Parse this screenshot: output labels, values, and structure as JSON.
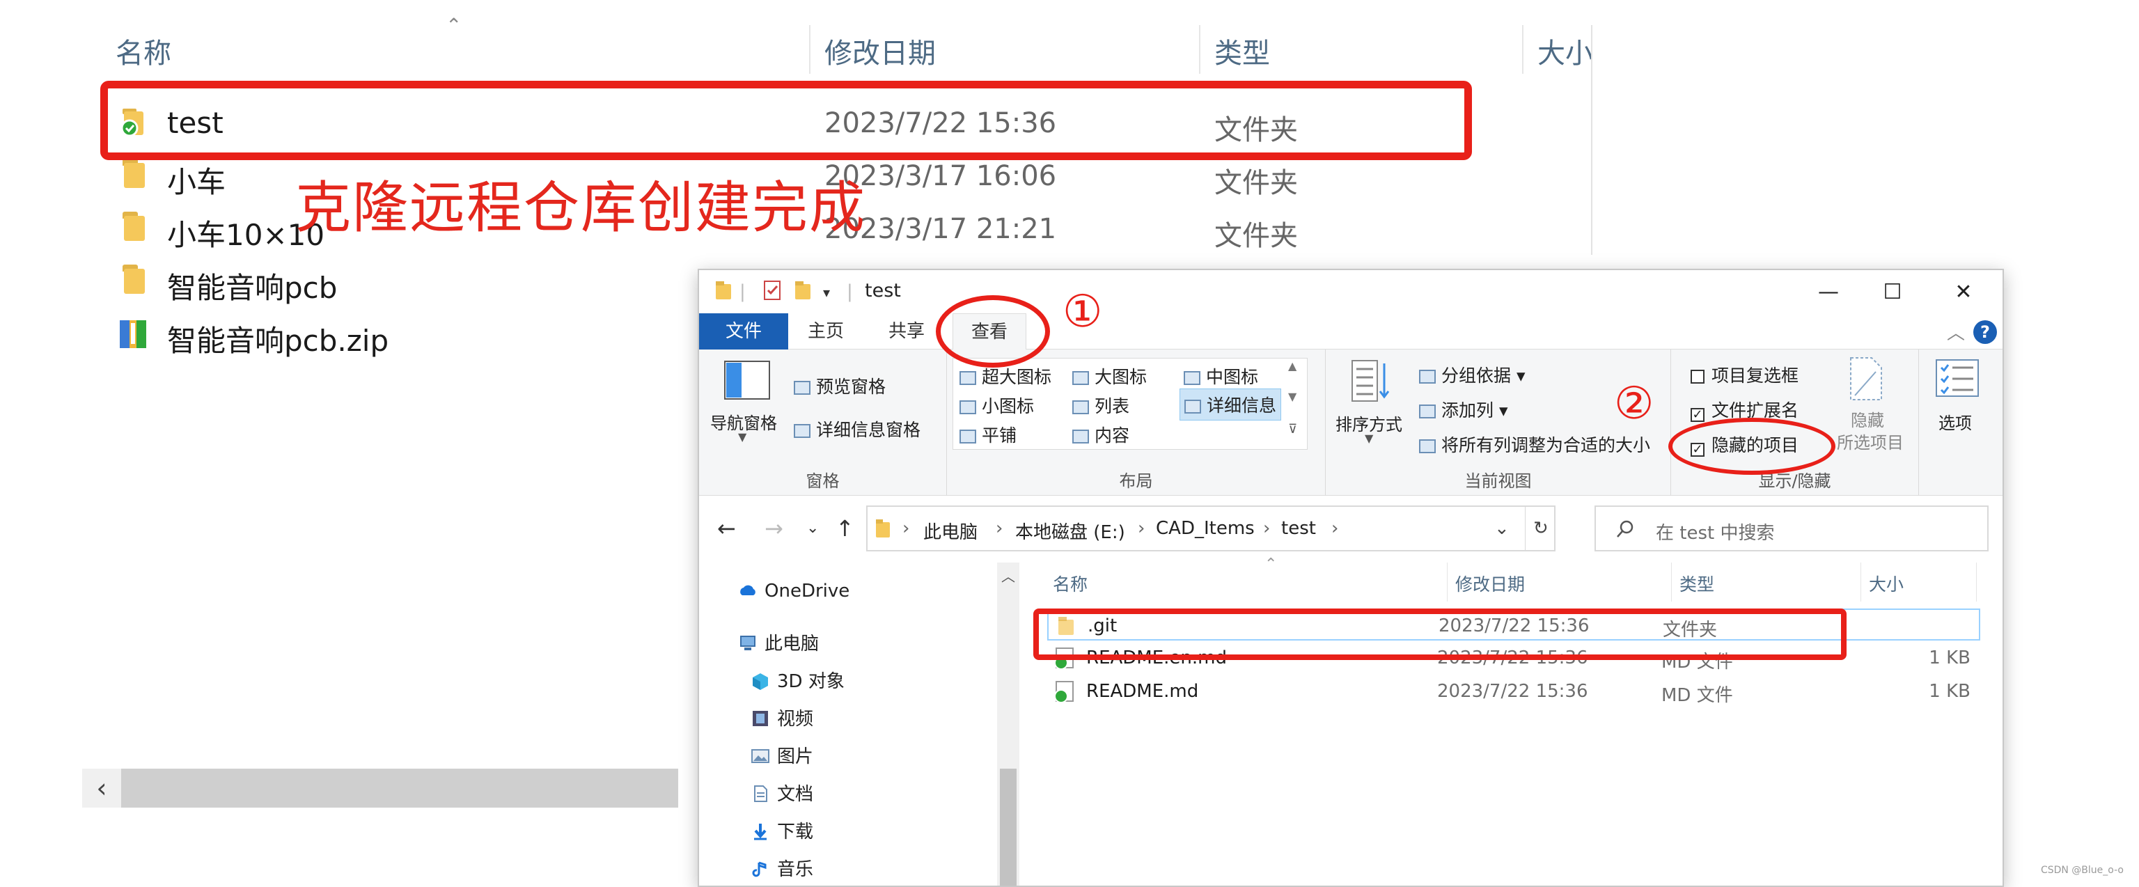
{
  "background": {
    "columns": {
      "name": "名称",
      "modified": "修改日期",
      "type": "类型",
      "size": "大小"
    },
    "rows": [
      {
        "name": "test",
        "date": "2023/7/22 15:36",
        "type": "文件夹",
        "icon": "git-folder-icon"
      },
      {
        "name": "小车",
        "date": "2023/3/17 16:06",
        "type": "文件夹",
        "icon": "folder-icon"
      },
      {
        "name": "小车10×10",
        "date": "2023/3/17 21:21",
        "type": "文件夹",
        "icon": "folder-icon"
      },
      {
        "name": "智能音响pcb",
        "type": "",
        "icon": "folder-icon"
      },
      {
        "name": "智能音响pcb.zip",
        "type": "",
        "icon": "zip-icon"
      }
    ],
    "scroll_left_glyph": "‹"
  },
  "caption": "克隆远程仓库创建完成",
  "annotations": {
    "step1": "①",
    "step2": "②"
  },
  "window": {
    "title": "test",
    "controls": {
      "minimize": "—",
      "maximize": "☐",
      "close": "✕"
    },
    "tabs": {
      "file": "文件",
      "home": "主页",
      "share": "共享",
      "view": "查看"
    },
    "help": "?",
    "ribbon": {
      "pane": {
        "nav_pane": "导航窗格",
        "preview": "预览窗格",
        "details": "详细信息窗格",
        "label": "窗格"
      },
      "layout": {
        "items": [
          "超大图标",
          "大图标",
          "中图标",
          "小图标",
          "列表",
          "详细信息",
          "平铺",
          "内容"
        ],
        "label": "布局"
      },
      "current_view": {
        "sort": "排序方式",
        "group": "分组依据",
        "add_col": "添加列",
        "fit_cols": "将所有列调整为合适的大小",
        "label": "当前视图"
      },
      "show_hide": {
        "item_checkboxes": "项目复选框",
        "extensions": "文件扩展名",
        "hidden_items": "隐藏的项目",
        "hide_selected_line1": "隐藏",
        "hide_selected_line2": "所选项目",
        "label": "显示/隐藏"
      },
      "options": "选项"
    },
    "address": {
      "crumbs": [
        "此电脑",
        "本地磁盘 (E:)",
        "CAD_Items",
        "test"
      ],
      "search_placeholder": "在 test 中搜索"
    },
    "nav": [
      "OneDrive",
      "此电脑",
      "3D 对象",
      "视频",
      "图片",
      "文档",
      "下载",
      "音乐"
    ],
    "columns": {
      "name": "名称",
      "modified": "修改日期",
      "type": "类型",
      "size": "大小"
    },
    "files": [
      {
        "name": ".git",
        "date": "2023/7/22 15:36",
        "type": "文件夹",
        "size": ""
      },
      {
        "name": "README.en.md",
        "date": "2023/7/22 15:36",
        "type": "MD 文件",
        "size": "1 KB"
      },
      {
        "name": "README.md",
        "date": "2023/7/22 15:36",
        "type": "MD 文件",
        "size": "1 KB"
      }
    ]
  },
  "credit": "CSDN @Blue_o-o"
}
